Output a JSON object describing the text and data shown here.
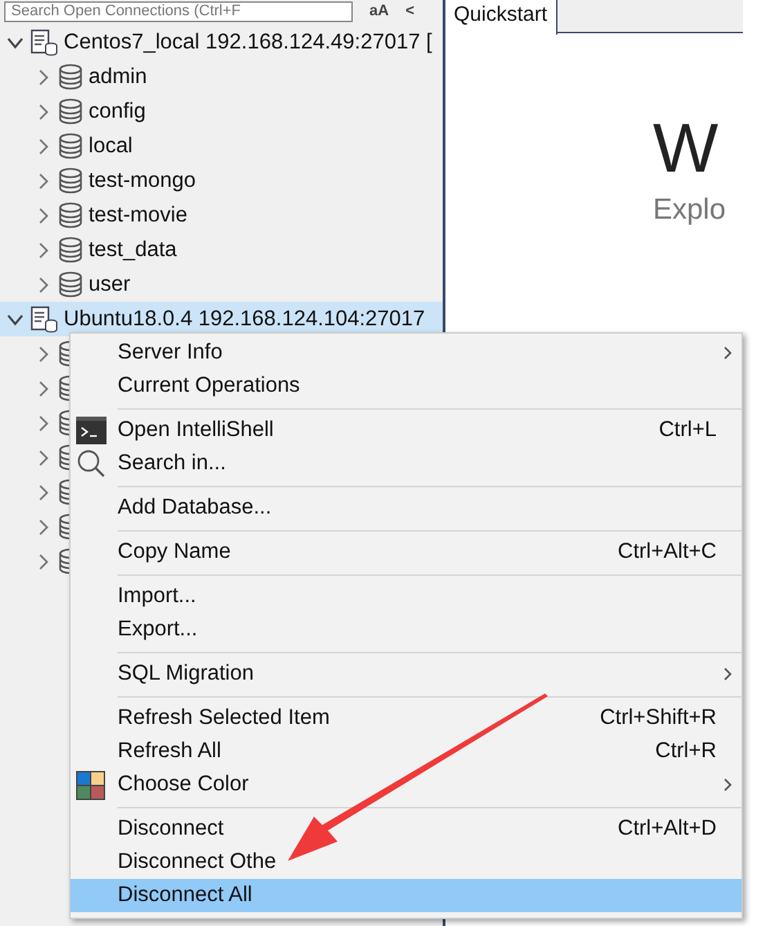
{
  "sidebar": {
    "search": {
      "placeholder": "Search Open Connections (Ctrl+F"
    },
    "toolbar": [
      "aA",
      "<"
    ],
    "tree": [
      {
        "label": "Centos7_local 192.168.124.49:27017 [",
        "kind": "server",
        "expanded": true,
        "selected": false,
        "children": [
          {
            "label": "admin",
            "kind": "database",
            "expanded": false
          },
          {
            "label": "config",
            "kind": "database",
            "expanded": false
          },
          {
            "label": "local",
            "kind": "database",
            "expanded": false
          },
          {
            "label": "test-mongo",
            "kind": "database",
            "expanded": false
          },
          {
            "label": "test-movie",
            "kind": "database",
            "expanded": false
          },
          {
            "label": "test_data",
            "kind": "database",
            "expanded": false
          },
          {
            "label": "user",
            "kind": "database",
            "expanded": false
          }
        ]
      },
      {
        "label": "Ubuntu18.0.4 192.168.124.104:27017",
        "kind": "server",
        "expanded": true,
        "selected": true,
        "children": [
          {
            "kind": "database",
            "expanded": false
          },
          {
            "kind": "database",
            "expanded": false
          },
          {
            "kind": "database",
            "expanded": false
          },
          {
            "kind": "database",
            "expanded": false
          },
          {
            "kind": "database",
            "expanded": false
          },
          {
            "kind": "database",
            "expanded": false
          },
          {
            "kind": "database",
            "expanded": false
          }
        ]
      }
    ]
  },
  "tabs": [
    {
      "label": "Quickstart",
      "selected": true
    }
  ],
  "quickstart": {
    "heading": "W",
    "subheading": "Explo"
  },
  "context_menu": {
    "items": [
      {
        "kind": "item",
        "label": "Server Info",
        "submenu": true,
        "selected": false
      },
      {
        "kind": "item",
        "label": "Current Operations",
        "selected": false
      },
      {
        "kind": "separator"
      },
      {
        "kind": "terminal",
        "label": "Open IntelliShell",
        "shortcut": "Ctrl+L",
        "selected": false
      },
      {
        "kind": "search",
        "label": "Search in...",
        "selected": false
      },
      {
        "kind": "separator"
      },
      {
        "kind": "item",
        "label": "Add Database...",
        "selected": false
      },
      {
        "kind": "separator"
      },
      {
        "kind": "item",
        "label": "Copy Name",
        "shortcut": "Ctrl+Alt+C",
        "selected": false
      },
      {
        "kind": "separator"
      },
      {
        "kind": "item",
        "label": "Import...",
        "selected": false
      },
      {
        "kind": "item",
        "label": "Export...",
        "selected": false
      },
      {
        "kind": "separator"
      },
      {
        "kind": "item",
        "label": "SQL Migration",
        "submenu": true,
        "selected": false
      },
      {
        "kind": "separator"
      },
      {
        "kind": "item",
        "label": "Refresh Selected Item",
        "shortcut": "Ctrl+Shift+R",
        "selected": false
      },
      {
        "kind": "item",
        "label": "Refresh All",
        "shortcut": "Ctrl+R",
        "selected": false
      },
      {
        "kind": "palette",
        "label": "Choose Color",
        "submenu": true,
        "selected": false
      },
      {
        "kind": "separator"
      },
      {
        "kind": "item",
        "label": "Disconnect",
        "shortcut": "Ctrl+Alt+D",
        "selected": false
      },
      {
        "kind": "item",
        "label": "Disconnect Othe",
        "selected": false
      },
      {
        "kind": "item",
        "label": "Disconnect All",
        "selected": true
      }
    ]
  },
  "annotation": {
    "kind": "arrow"
  }
}
